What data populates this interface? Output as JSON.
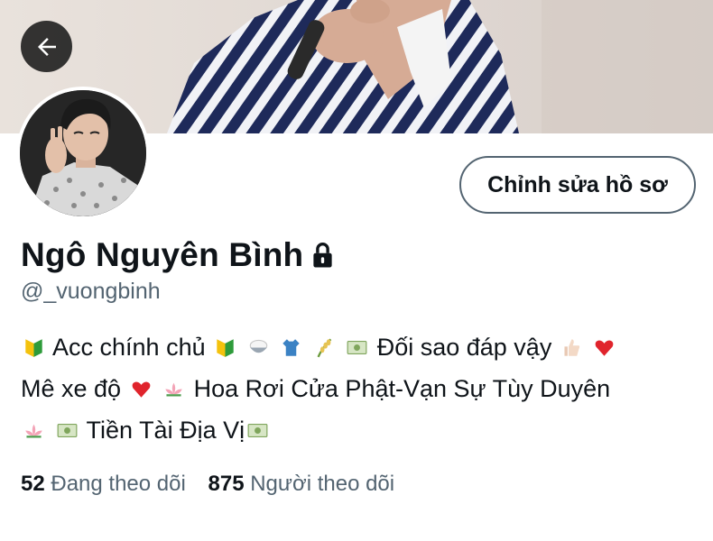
{
  "header": {
    "back_icon": "arrow-left-icon",
    "banner_colors": {
      "background": "#e2dbd6",
      "shirt_navy": "#1e2a5a",
      "shirt_white": "#f1f2f6",
      "skin": "#d6ab95"
    }
  },
  "profile": {
    "display_name": "Ngô Nguyên Bình",
    "protected_icon": "lock-icon",
    "handle": "@_vuongbinh",
    "edit_button_label": "Chỉnh sửa hồ sơ"
  },
  "bio": {
    "line1": {
      "text_a": "Acc chính chủ",
      "text_b": "Đối sao đáp vậy",
      "emojis": [
        "beginner-badge-icon",
        "beginner-badge-icon",
        "rice-bowl-icon",
        "shirt-icon",
        "rice-ear-icon",
        "money-icon",
        "thumbs-up-icon",
        "red-heart-icon"
      ]
    },
    "line2": {
      "text_a": "Mê xe độ",
      "text_b": "Hoa Rơi Cửa Phật-Vạn Sự Tùy Duyên",
      "emojis": [
        "red-heart-icon",
        "lotus-icon"
      ]
    },
    "line3": {
      "text_a": "Tiền Tài Địa Vị",
      "emojis": [
        "lotus-icon",
        "money-icon",
        "money-icon"
      ]
    }
  },
  "stats": {
    "following_count": "52",
    "following_label": "Đang theo dõi",
    "followers_count": "875",
    "followers_label": "Người theo dõi"
  },
  "colors": {
    "text_primary": "#0f1419",
    "text_secondary": "#536471",
    "button_border": "#536471"
  }
}
